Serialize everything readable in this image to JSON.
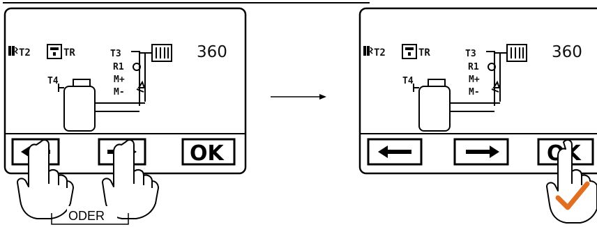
{
  "left_panel": {
    "sensor_t2": "T2",
    "sensor_tr": "TR",
    "sensor_t3": "T3",
    "relay_r1": "R1",
    "mixer_open": "M+",
    "mixer_close": "M-",
    "sensor_t4": "T4",
    "value": "360",
    "buttons": {
      "left_arrow": "left-arrow",
      "right_arrow": "right-arrow",
      "ok_label": "OK"
    }
  },
  "right_panel": {
    "sensor_t2": "T2",
    "sensor_tr": "TR",
    "sensor_t3": "T3",
    "relay_r1": "R1",
    "mixer_open": "M+",
    "mixer_close": "M-",
    "sensor_t4": "T4",
    "value": "360",
    "buttons": {
      "left_arrow": "left-arrow",
      "right_arrow": "right-arrow",
      "ok_label": "OK"
    }
  },
  "or_label": "ODER",
  "icons": [
    "hand-press-icon",
    "arrow-right-icon",
    "checkmark-icon",
    "radiator-icon",
    "tank-icon"
  ],
  "colors": {
    "checkmark": "#e07020",
    "line": "#000000",
    "panel_bg": "#ffffff"
  }
}
